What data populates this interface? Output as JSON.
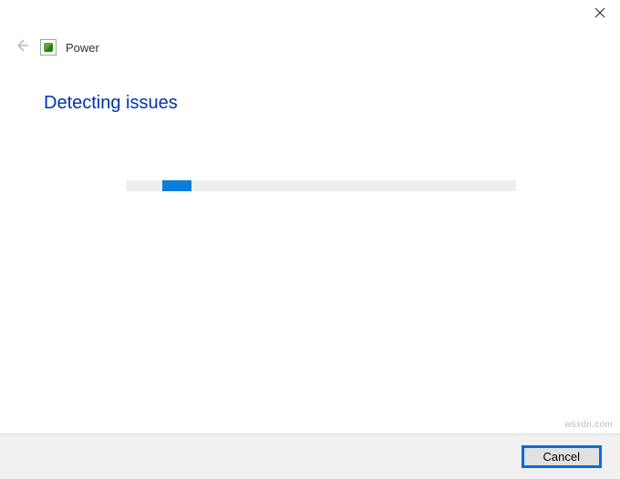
{
  "window": {
    "title": "Power"
  },
  "heading": "Detecting issues",
  "footer": {
    "cancel_label": "Cancel"
  },
  "watermark": "wsxdn.com"
}
